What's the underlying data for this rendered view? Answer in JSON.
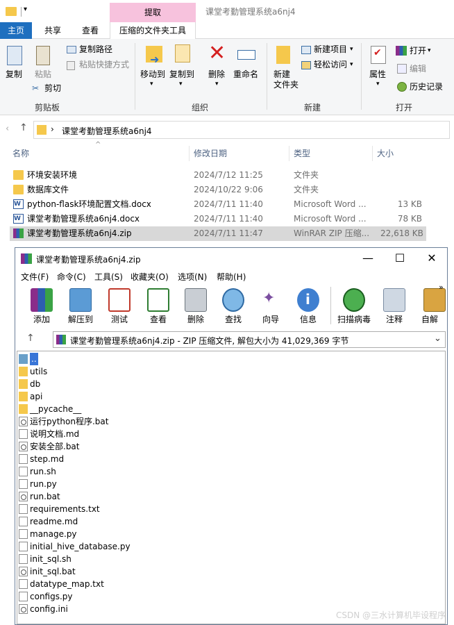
{
  "explorer": {
    "window_title": "课堂考勤管理系统a6nj4",
    "context_tab_top": "提取",
    "tabs": [
      "主页",
      "共享",
      "查看",
      "压缩的文件夹工具"
    ],
    "ribbon": {
      "clipboard": {
        "copy": "复制",
        "paste": "粘贴",
        "copy_path": "复制路径",
        "paste_shortcut": "粘贴快捷方式",
        "cut": "剪切",
        "label": "剪贴板"
      },
      "organize": {
        "move_to": "移动到",
        "copy_to": "复制到",
        "delete": "删除",
        "rename": "重命名",
        "label": "组织"
      },
      "new": {
        "new_folder": "新建\n文件夹",
        "new_item": "新建项目",
        "easy_access": "轻松访问",
        "label": "新建"
      },
      "open": {
        "properties": "属性",
        "open": "打开",
        "edit": "编辑",
        "history": "历史记录",
        "label": "打开"
      }
    },
    "address": {
      "path": "课堂考勤管理系统a6nj4"
    },
    "columns": {
      "name": "名称",
      "date": "修改日期",
      "type": "类型",
      "size": "大小"
    },
    "files": [
      {
        "name": "环境安装环境",
        "date": "2024/7/12 11:25",
        "type": "文件夹",
        "size": "",
        "icon": "folder-icon"
      },
      {
        "name": "数据库文件",
        "date": "2024/10/22 9:06",
        "type": "文件夹",
        "size": "",
        "icon": "folder-icon"
      },
      {
        "name": "python-flask环境配置文档.docx",
        "date": "2024/7/11 11:40",
        "type": "Microsoft Word ...",
        "size": "13 KB",
        "icon": "word-icon"
      },
      {
        "name": "课堂考勤管理系统a6nj4.docx",
        "date": "2024/7/11 11:40",
        "type": "Microsoft Word ...",
        "size": "78 KB",
        "icon": "word-icon"
      },
      {
        "name": "课堂考勤管理系统a6nj4.zip",
        "date": "2024/7/11 11:47",
        "type": "WinRAR ZIP 压缩...",
        "size": "22,618 KB",
        "icon": "rar-icon"
      }
    ]
  },
  "winrar": {
    "title": "课堂考勤管理系统a6nj4.zip",
    "menu": [
      "文件(F)",
      "命令(C)",
      "工具(S)",
      "收藏夹(O)",
      "选项(N)",
      "帮助(H)"
    ],
    "toolbar": [
      "添加",
      "解压到",
      "测试",
      "查看",
      "删除",
      "查找",
      "向导",
      "信息",
      "扫描病毒",
      "注释",
      "自解"
    ],
    "path_text": "课堂考勤管理系统a6nj4.zip - ZIP 压缩文件, 解包大小为 41,029,369 字节",
    "items": [
      {
        "name": "..",
        "kind": "up"
      },
      {
        "name": "utils",
        "kind": "folder"
      },
      {
        "name": "db",
        "kind": "folder"
      },
      {
        "name": "api",
        "kind": "folder"
      },
      {
        "name": "__pycache__",
        "kind": "folder"
      },
      {
        "name": "运行python程序.bat",
        "kind": "bat"
      },
      {
        "name": "说明文档.md",
        "kind": "file"
      },
      {
        "name": "安装全部.bat",
        "kind": "bat"
      },
      {
        "name": "step.md",
        "kind": "file"
      },
      {
        "name": "run.sh",
        "kind": "file"
      },
      {
        "name": "run.py",
        "kind": "file"
      },
      {
        "name": "run.bat",
        "kind": "bat"
      },
      {
        "name": "requirements.txt",
        "kind": "file"
      },
      {
        "name": "readme.md",
        "kind": "file"
      },
      {
        "name": "manage.py",
        "kind": "file"
      },
      {
        "name": "initial_hive_database.py",
        "kind": "file"
      },
      {
        "name": "init_sql.sh",
        "kind": "file"
      },
      {
        "name": "init_sql.bat",
        "kind": "bat"
      },
      {
        "name": "datatype_map.txt",
        "kind": "file"
      },
      {
        "name": "configs.py",
        "kind": "file"
      },
      {
        "name": "config.ini",
        "kind": "bat"
      }
    ]
  },
  "watermark": "CSDN @三水计算机毕设程序"
}
